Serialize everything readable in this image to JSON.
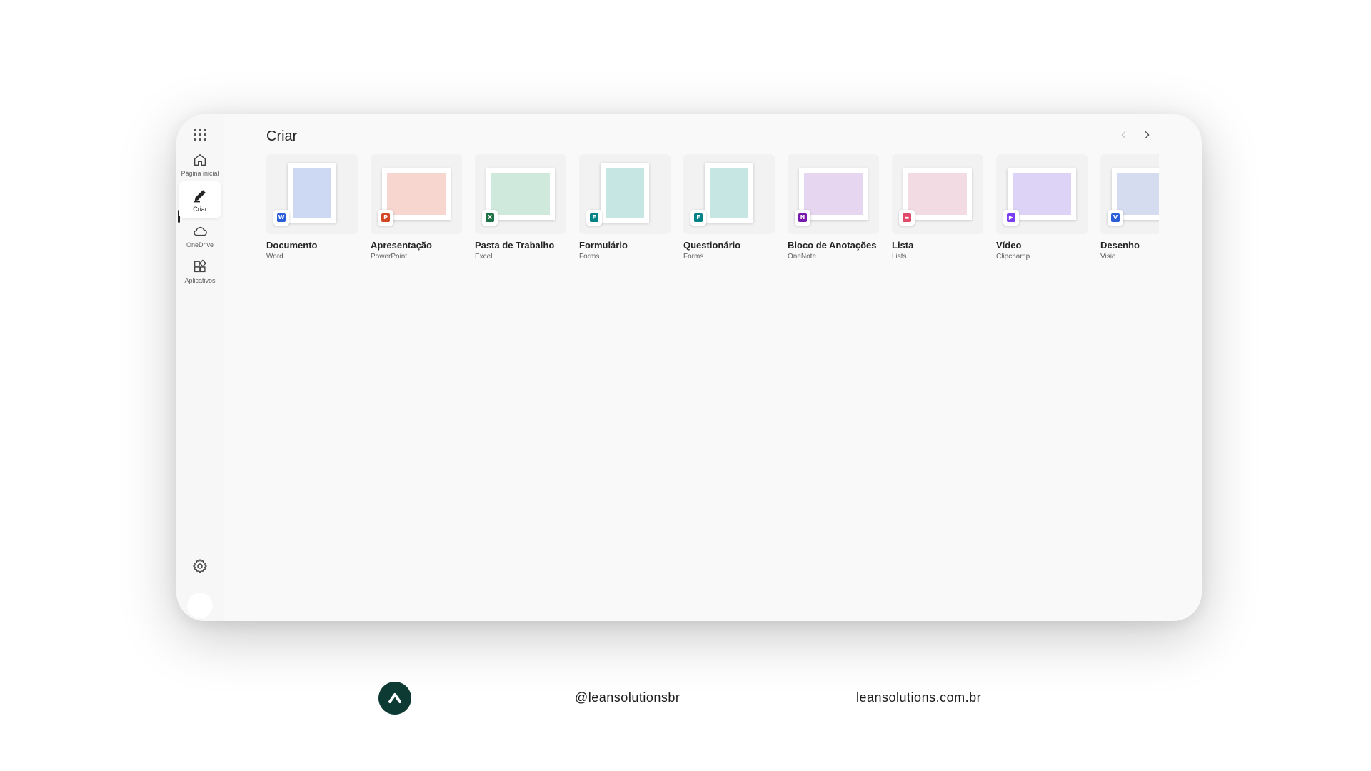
{
  "sidebar": {
    "items": [
      {
        "label": "Página inicial",
        "icon": "home-icon"
      },
      {
        "label": "Criar",
        "icon": "pen-icon"
      },
      {
        "label": "OneDrive",
        "icon": "cloud-icon"
      },
      {
        "label": "Aplicativos",
        "icon": "apps-icon"
      }
    ],
    "active": "Criar"
  },
  "main": {
    "title": "Criar",
    "cards": [
      {
        "name": "Documento",
        "app": "Word",
        "color": "#2b5fd9",
        "tint": "#cdd9f3",
        "badge": "W"
      },
      {
        "name": "Apresentação",
        "app": "PowerPoint",
        "color": "#d24726",
        "tint": "#f6d6cf",
        "badge": "P"
      },
      {
        "name": "Pasta de Trabalho",
        "app": "Excel",
        "color": "#1e7145",
        "tint": "#cfe9dc",
        "badge": "X"
      },
      {
        "name": "Formulário",
        "app": "Forms",
        "color": "#038387",
        "tint": "#c5e6e2",
        "badge": "F"
      },
      {
        "name": "Questionário",
        "app": "Forms",
        "color": "#038387",
        "tint": "#c5e6e2",
        "badge": "F"
      },
      {
        "name": "Bloco de Anotações",
        "app": "OneNote",
        "color": "#7719aa",
        "tint": "#e6d6ef",
        "badge": "N"
      },
      {
        "name": "Lista",
        "app": "Lists",
        "color": "#e14a6b",
        "tint": "#f3dbe3",
        "badge": "≡"
      },
      {
        "name": "Vídeo",
        "app": "Clipchamp",
        "color": "#7b3ff2",
        "tint": "#dcd3f6",
        "badge": "▶"
      },
      {
        "name": "Desenho",
        "app": "Visio",
        "color": "#2b5fd9",
        "tint": "#d6dcef",
        "badge": "V"
      }
    ]
  },
  "footer": {
    "handle": "@leansolutionsbr",
    "site": "leansolutions.com.br"
  }
}
